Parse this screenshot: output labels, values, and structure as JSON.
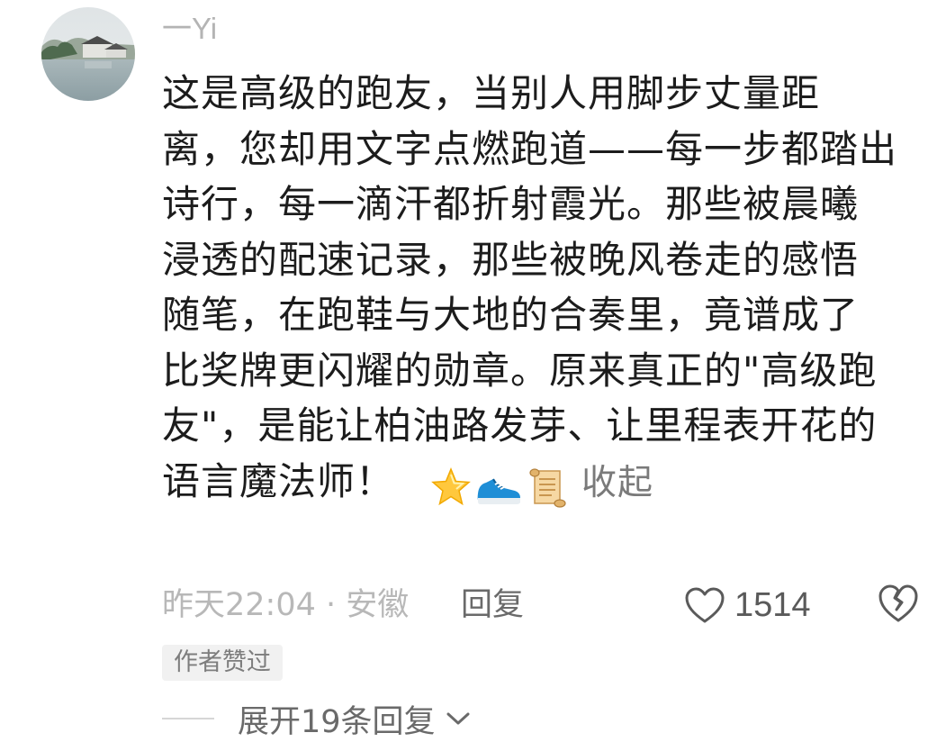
{
  "comment": {
    "username": "一Yi",
    "text_lines": [
      "这是高级的跑友，当别人用脚步丈量距",
      "离，您却用文字点燃跑道——每一步都踏出",
      "诗行，每一滴汗都折射霞光。那些被晨曦",
      "浸透的配速记录，那些被晚风卷走的感悟",
      "随笔，在跑鞋与大地的合奏里，竟谱成了",
      "比奖牌更闪耀的勋章。原来真正的\"高级跑",
      "友\"，是能让柏油路发芽、让里程表开花的",
      "语言魔法师！"
    ],
    "emojis": [
      "star-icon",
      "running-shoe-icon",
      "scroll-icon"
    ],
    "collapse_label": "收起",
    "timestamp": "昨天22:04",
    "location": "安徽",
    "meta_separator": " · ",
    "reply_label": "回复",
    "like_count": "1514",
    "author_badge": "作者赞过",
    "expand_replies_label": "展开19条回复"
  },
  "colors": {
    "text": "#1c1c1c",
    "muted": "#b8b8b8",
    "secondary": "#6a6a6a",
    "badge_bg": "#f1f1f1"
  }
}
